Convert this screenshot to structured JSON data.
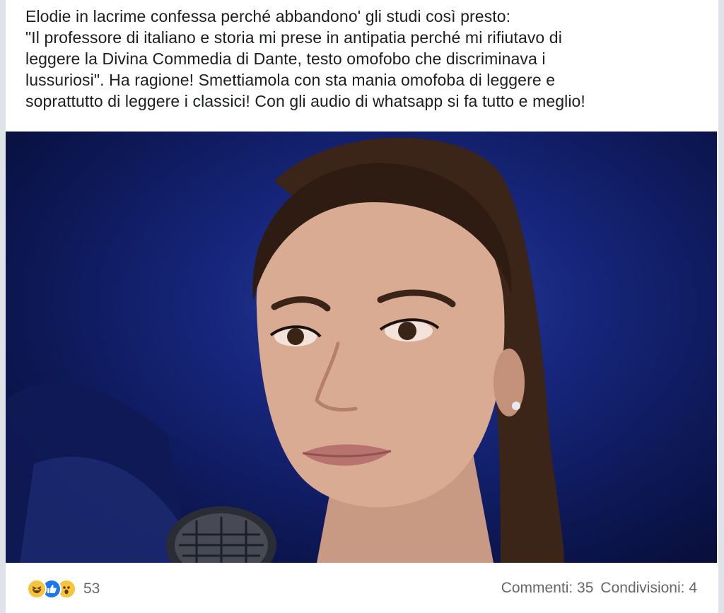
{
  "post": {
    "text": "Elodie in lacrime confessa perché abbandono' gli studi così presto:\n\"Il professore di italiano e storia mi prese in antipatia perché mi rifiutavo di\nleggere la Divina Commedia di Dante, testo omofobo che discriminava i\nlussuriosi\". Ha ragione! Smettiamola con sta mania omofoba di leggere e\nsoprattutto di leggere i classici! Con gli audio di whatsapp si fa tutto e meglio!"
  },
  "reactions": {
    "icons": [
      "haha-icon",
      "like-icon",
      "wow-icon"
    ],
    "count": "53"
  },
  "stats": {
    "comments": "Commenti: 35",
    "shares": "Condivisioni: 4"
  },
  "colors": {
    "text": "#1c1e21",
    "muted": "#65676b",
    "like_blue": "#1a79f2",
    "emoji_yellow": "#f7c23c"
  }
}
